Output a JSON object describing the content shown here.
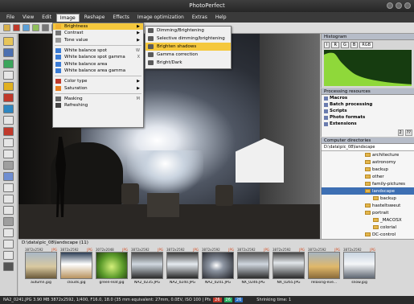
{
  "window": {
    "title": "PhotoPerfect"
  },
  "menubar": {
    "items": [
      "File",
      "View",
      "Edit",
      "Image",
      "Reshape",
      "Effects",
      "Image optimization",
      "Extras",
      "Help"
    ],
    "active_index": 3
  },
  "image_menu": {
    "items": [
      {
        "label": "Brightness",
        "has_submenu": true,
        "highlighted": false
      },
      {
        "label": "Contrast",
        "has_submenu": true
      },
      {
        "label": "Tone value",
        "has_submenu": true
      },
      {
        "label": "White balance spot",
        "shortcut": "W"
      },
      {
        "label": "White balance spot gamma",
        "shortcut": "X"
      },
      {
        "label": "White balance area"
      },
      {
        "label": "White balance area gamma"
      },
      {
        "label": "Color type",
        "has_submenu": true
      },
      {
        "label": "Saturation",
        "has_submenu": true
      },
      {
        "label": "Masking",
        "shortcut": "M"
      },
      {
        "label": "Refreshing"
      }
    ]
  },
  "brightness_submenu": {
    "items": [
      "Dimming/Brightening",
      "Selective dimming/brightening",
      "Brighten shadows",
      "Gamma correction",
      "Bright/Dark"
    ],
    "highlighted_index": 2
  },
  "histogram": {
    "title": "Histogram",
    "tabs": [
      "I",
      "R",
      "G",
      "B",
      "RGB"
    ],
    "selected_tab": "RGB"
  },
  "resources": {
    "title": "Processing resources",
    "items": [
      "Macros",
      "Batch processing",
      "Scripts",
      "Photo formats",
      "Extensions"
    ],
    "status": [
      "2",
      "??"
    ]
  },
  "directories": {
    "title": "Computer directories",
    "path": "D:\\data\\pic_08\\landscape",
    "items": [
      {
        "label": "architecture",
        "indent": 1
      },
      {
        "label": "astronomy",
        "indent": 1
      },
      {
        "label": "backup",
        "indent": 1
      },
      {
        "label": "other",
        "indent": 1
      },
      {
        "label": "family-pictures",
        "indent": 1
      },
      {
        "label": "landscape",
        "indent": 1,
        "selected": true
      },
      {
        "label": "backup",
        "indent": 2
      },
      {
        "label": "hasteltsweut",
        "indent": 1
      },
      {
        "label": "portrait",
        "indent": 1
      },
      {
        "label": "_MACOSX",
        "indent": 2
      },
      {
        "label": "colorial",
        "indent": 2
      },
      {
        "label": "DC-control",
        "indent": 1
      }
    ]
  },
  "filmstrip": {
    "path": "D:\\data\\pic_08\\landscape (11)",
    "thumbnails": [
      {
        "meta": "3872x2592",
        "ext": "JPG",
        "name": "autumn.jpg"
      },
      {
        "meta": "3872x2592",
        "ext": "JPG",
        "name": "clouds.jpg"
      },
      {
        "meta": "3072x2048",
        "ext": "JPG",
        "name": "green-leaf.jpg"
      },
      {
        "meta": "3872x2592",
        "ext": "JPG",
        "name": "NA2_0235.JPG"
      },
      {
        "meta": "3872x2592",
        "ext": "JPG",
        "name": "NA2_0240.JPG"
      },
      {
        "meta": "3872x2592",
        "ext": "JPG",
        "name": "NA2_0241.JPG"
      },
      {
        "meta": "3872x2592",
        "ext": "JPG",
        "name": "NX_0246.JPG"
      },
      {
        "meta": "3872x2592",
        "ext": "JPG",
        "name": "NX_0265.JPG"
      },
      {
        "meta": "3872x2592",
        "ext": "JPG",
        "name": "relaxing-eve..."
      },
      {
        "meta": "3872x2592",
        "ext": "JPG",
        "name": "snow.jpg"
      }
    ]
  },
  "statusbar": {
    "text": "NA2_0241.JPG  3.90 MB  3872x2592, 1/400, F16.0, 18.0 (35 mm equivalent: 27mm, 0.0EV, ISO 100  | Pfs",
    "rgb": [
      "26",
      "26",
      "26"
    ],
    "right": "Shrinking time: 1"
  },
  "colors": {
    "highlight": "#f5c83d",
    "histogram_fill": "#8fd83a",
    "selection": "#3d6fb3"
  }
}
